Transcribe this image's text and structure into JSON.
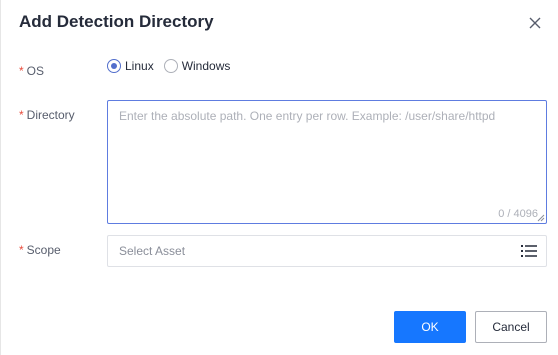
{
  "dialog": {
    "title": "Add Detection Directory"
  },
  "form": {
    "required_mark": "*",
    "os": {
      "label": "OS",
      "options": [
        "Linux",
        "Windows"
      ],
      "selected": "Linux"
    },
    "directory": {
      "label": "Directory",
      "placeholder": "Enter the absolute path. One entry per row. Example: /user/share/httpd",
      "value": "",
      "counter": "0 / 4096"
    },
    "scope": {
      "label": "Scope",
      "placeholder": "Select Asset"
    }
  },
  "buttons": {
    "ok": "OK",
    "cancel": "Cancel"
  },
  "colors": {
    "primary": "#1677ff",
    "radio_checked": "#526ecc",
    "required": "#e84c3d",
    "focus_border": "#5e7ce0"
  },
  "icons": {
    "close": "close-icon",
    "list": "list-icon",
    "resize": "resize-handle-icon"
  }
}
